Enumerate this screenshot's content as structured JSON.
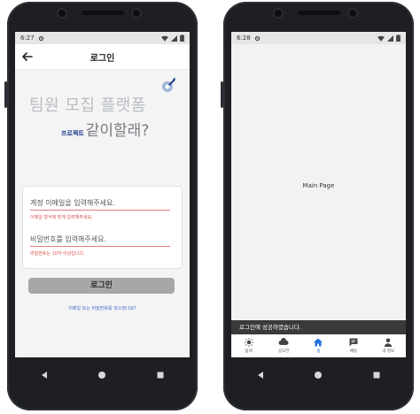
{
  "left_phone": {
    "status_time": "6:27",
    "title": "로그인",
    "hero": {
      "line1": "팀원 모집 플랫폼",
      "tag": "프로젝트",
      "line2": "같이할래?"
    },
    "email": {
      "placeholder": "계정 이메일을 입력해주세요.",
      "error": "이메일 형식에 맞게 입력해주세요."
    },
    "password": {
      "placeholder": "비밀번호를 입력해주세요.",
      "error": "비밀번호는 10자 이상입니다."
    },
    "login_button": "로그인",
    "forgot_link": "이메일 또는 비밀번호를 잊으셨나요?"
  },
  "right_phone": {
    "status_time": "6:28",
    "main_text": "Main Page",
    "snackbar": "로그인에 성공하였습니다.",
    "bottom_nav": [
      {
        "label": "탐색",
        "icon": "sun-icon"
      },
      {
        "label": "공모전",
        "icon": "cloud-icon"
      },
      {
        "label": "홈",
        "icon": "home-icon",
        "active": true
      },
      {
        "label": "채팅",
        "icon": "chat-icon"
      },
      {
        "label": "내 정보",
        "icon": "person-icon"
      }
    ]
  },
  "colors": {
    "accent": "#1f6fe0",
    "error": "#d9534f",
    "button": "#a7a7a7",
    "phone_body": "#1d1f22"
  }
}
